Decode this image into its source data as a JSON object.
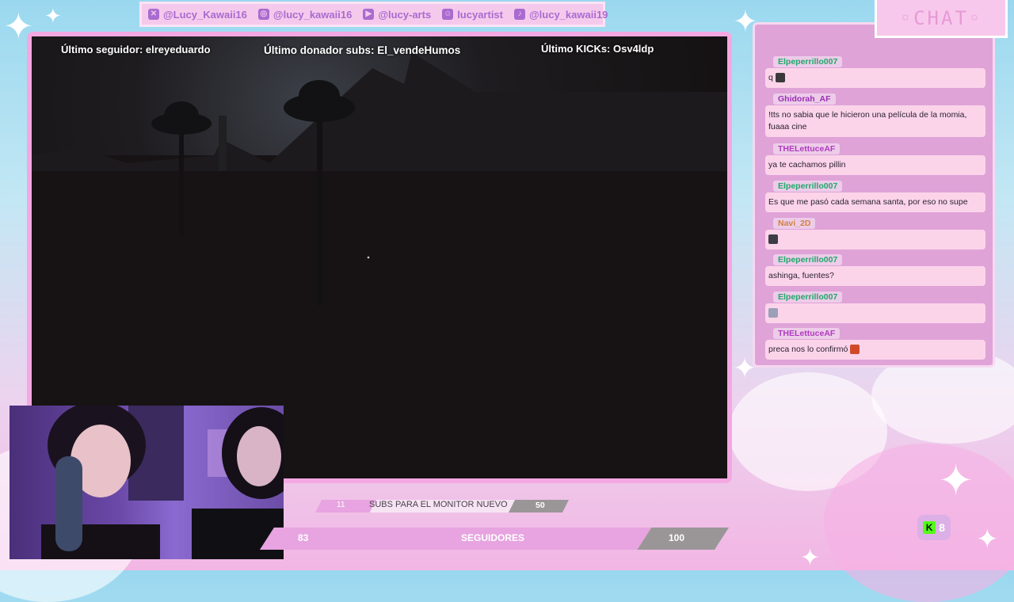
{
  "social": [
    {
      "icon": "x-icon",
      "handle": "@Lucy_Kawaii16"
    },
    {
      "icon": "instagram-icon",
      "handle": "@lucy_kawaii16"
    },
    {
      "icon": "youtube-icon",
      "handle": "@lucy-arts"
    },
    {
      "icon": "discord-icon",
      "handle": "lucyartist"
    },
    {
      "icon": "tiktok-icon",
      "handle": "@lucy_kawaii19"
    }
  ],
  "overlay": {
    "last_follower": "Último seguidor: elreyeduardo",
    "last_donor": "Último donador subs: El_vendeHumos",
    "last_kicks": "Último KICKs: Osv4ldp"
  },
  "goals": {
    "subs": {
      "current": "11",
      "label": "SUBS PARA EL MONITOR NUEVO",
      "target": "50",
      "progress": 0.22
    },
    "followers": {
      "current": "83",
      "label": "SEGUIDORES",
      "target": "100",
      "progress": 0.83
    }
  },
  "chat": {
    "title": "◦CHAT◦",
    "messages": [
      {
        "user": "Elpeperrillo007",
        "text": "q",
        "name_color": "#1fa86a",
        "emote": true
      },
      {
        "user": "Ghidorah_AF",
        "text": "!tts no sabia que le hicieron una película de la momia, fuaaa cine",
        "name_color": "#9a2fb5",
        "emote": false
      },
      {
        "user": "THELettuceAF",
        "text": "ya te cachamos pillin",
        "name_color": "#b03ac0",
        "emote": false
      },
      {
        "user": "Elpeperrillo007",
        "text": "Es que me pasó cada semana santa, por eso no supe",
        "name_color": "#1fa86a",
        "emote": false
      },
      {
        "user": "Navi_2D",
        "text": "",
        "name_color": "#d2813a",
        "emote": true
      },
      {
        "user": "Elpeperrillo007",
        "text": "ashinga, fuentes?",
        "name_color": "#1fa86a",
        "emote": false
      },
      {
        "user": "Elpeperrillo007",
        "text": "",
        "name_color": "#1fa86a",
        "emote": true
      },
      {
        "user": "THELettuceAF",
        "text": "preca nos lo confirmó",
        "name_color": "#b03ac0",
        "emote": true
      }
    ]
  },
  "kick": {
    "count": "8",
    "icon": "kick-icon"
  },
  "colors": {
    "accent_pink": "#f4a8e2",
    "chat_bg": "#dfa3d8",
    "bubble": "#fcd4ea",
    "kick_green": "#53fc18"
  }
}
